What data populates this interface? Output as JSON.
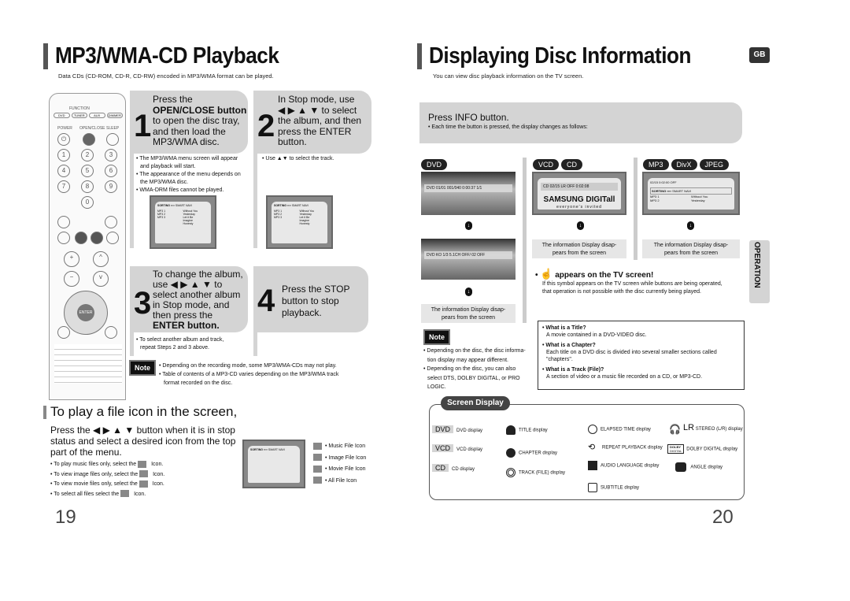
{
  "left_page": {
    "title": "MP3/WMA-CD Playback",
    "subtitle": "Data CDs (CD-ROM, CD-R, CD-RW) encoded in MP3/WMA format can be played.",
    "steps": [
      {
        "num": "1",
        "lines": [
          "Press the",
          "OPEN/CLOSE button",
          "to open the disc tray,",
          "and then load the",
          "MP3/WMA disc."
        ],
        "bullets": [
          "The MP3/WMA menu screen will appear",
          "and playback will start.",
          "The appearance of the menu depends on",
          "the MP3/WMA disc.",
          "WMA-DRM files cannot be played."
        ]
      },
      {
        "num": "2",
        "lines": [
          "In Stop mode, use",
          "◀ ▶ ▲ ▼ to select",
          "the album, and then",
          "press the ENTER",
          "button."
        ],
        "bullets": [
          "Use ▲▼ to select the track."
        ]
      },
      {
        "num": "3",
        "lines": [
          "To change the album,",
          "use ◀ ▶ ▲ ▼ to",
          "select another album",
          "in Stop mode, and",
          "then press the",
          "ENTER button."
        ],
        "bullets": [
          "To select another album and track,",
          "repeat Steps 2 and 3 above."
        ]
      },
      {
        "num": "4",
        "lines": [
          "Press the STOP",
          "button to stop",
          "playback."
        ]
      }
    ],
    "note_label": "Note",
    "notes": [
      "Depending on the recording mode, some MP3/WMA-CDs may not play.",
      "Table of contents of a MP3-CD varies depending on the MP3/WMA track",
      "format recorded on the disc."
    ],
    "file_icon_heading": "To play a file icon in the screen,",
    "file_icon_intro": [
      "Press the ◀ ▶ ▲ ▼ button when it is in stop",
      "status and select a desired icon from the top",
      "part of the menu."
    ],
    "file_icon_bullets": [
      {
        "pre": "To play music files only, select the",
        "post": "Icon."
      },
      {
        "pre": "To view image files only, select the",
        "post": "Icon."
      },
      {
        "pre": "To view movie files only, select the",
        "post": "Icon."
      },
      {
        "pre": "To select all files select the",
        "post": "Icon."
      }
    ],
    "icon_legend": [
      "Music File Icon",
      "Image File Icon",
      "Movie File Icon",
      "All File Icon"
    ],
    "menu_screen": {
      "sorting": "SORTING",
      "smart_navi": "SMART NAVI",
      "albums": [
        "MP3 1",
        "MP3 2",
        "MP3 3"
      ],
      "tracks": [
        "Without You",
        "Yesterday",
        "Let it Be",
        "Imagine",
        "Honesty"
      ]
    },
    "remote": {
      "function": "FUNCTION",
      "buttons": [
        "DVD",
        "TUNER",
        "AUX",
        "DIMMER"
      ],
      "power": "POWER",
      "open_close": "OPEN/CLOSE",
      "sleep": "SLEEP",
      "digits": [
        "1",
        "2",
        "3",
        "4",
        "5",
        "6",
        "7",
        "8",
        "9",
        "0"
      ],
      "enter": "ENTER"
    },
    "page_number": "19"
  },
  "right_page": {
    "title": "Displaying Disc Information",
    "badge": "GB",
    "subtitle": "You can view disc playback information  on the TV screen.",
    "press_info": "Press INFO button.",
    "press_info_bullet": "Each time the button is pressed, the display changes as follows:",
    "columns": [
      {
        "tags": [
          "DVD"
        ],
        "osd1": "DVD  01/01  001/040  0:00:37  1/1",
        "osd2": "DVD  KO 1/3  5.1CH  OFF/ 02  OFF",
        "caption": [
          "The information Display disap-",
          "pears from the screen"
        ]
      },
      {
        "tags": [
          "VCD",
          "CD"
        ],
        "osd1": "CD  02/15  LR  OFF  0:02:08",
        "logo": "SAMSUNG DIGITall",
        "logo_sub": "everyone's invited",
        "caption": [
          "The information Display disap-",
          "pears from the screen"
        ]
      },
      {
        "tags": [
          "MP3",
          "DivX",
          "JPEG"
        ],
        "osd1": "02/15  0:02:00  OFF",
        "caption": [
          "The information Display disap-",
          "pears from the screen"
        ]
      }
    ],
    "side_tab": "OPERATION",
    "hand_title": "appears on the TV screen!",
    "hand_text": [
      "If this symbol appears on the TV screen while buttons are being operated,",
      "that operation is not possible with the disc currently being played."
    ],
    "note_label": "Note",
    "notes": [
      "Depending on the disc, the disc informa-",
      "tion display may appear different.",
      "Depending on the disc, you can also",
      "select DTS, DOLBY DIGITAL, or PRO",
      "LOGIC."
    ],
    "definitions": [
      {
        "q": "What is a Title?",
        "a": "A movie contained in a DVD-VIDEO disc."
      },
      {
        "q": "What is a Chapter?",
        "a": "Each title on a DVD disc is divided into several smaller sections called \"chapters\"."
      },
      {
        "q": "What is a Track (File)?",
        "a": "A section of video or a music file recorded on a CD, or MP3-CD."
      }
    ],
    "screen_display": {
      "title": "Screen Display",
      "discs": [
        {
          "tag": "DVD",
          "label": "DVD display"
        },
        {
          "tag": "VCD",
          "label": "VCD display"
        },
        {
          "tag": "CD",
          "label": "CD display"
        }
      ],
      "items": [
        "TITLE display",
        "CHAPTER display",
        "TRACK (FILE) display",
        "ELAPSED TIME display",
        "REPEAT PLAYBACK display",
        "AUDIO LANGUAGE display",
        "SUBTITLE display",
        "STEREO (L/R) display",
        "DOLBY DIGITAL display",
        "ANGLE display"
      ],
      "lr": "LR",
      "dolby": "DOLBY",
      "digital": "DIGITAL"
    },
    "page_number": "20"
  }
}
